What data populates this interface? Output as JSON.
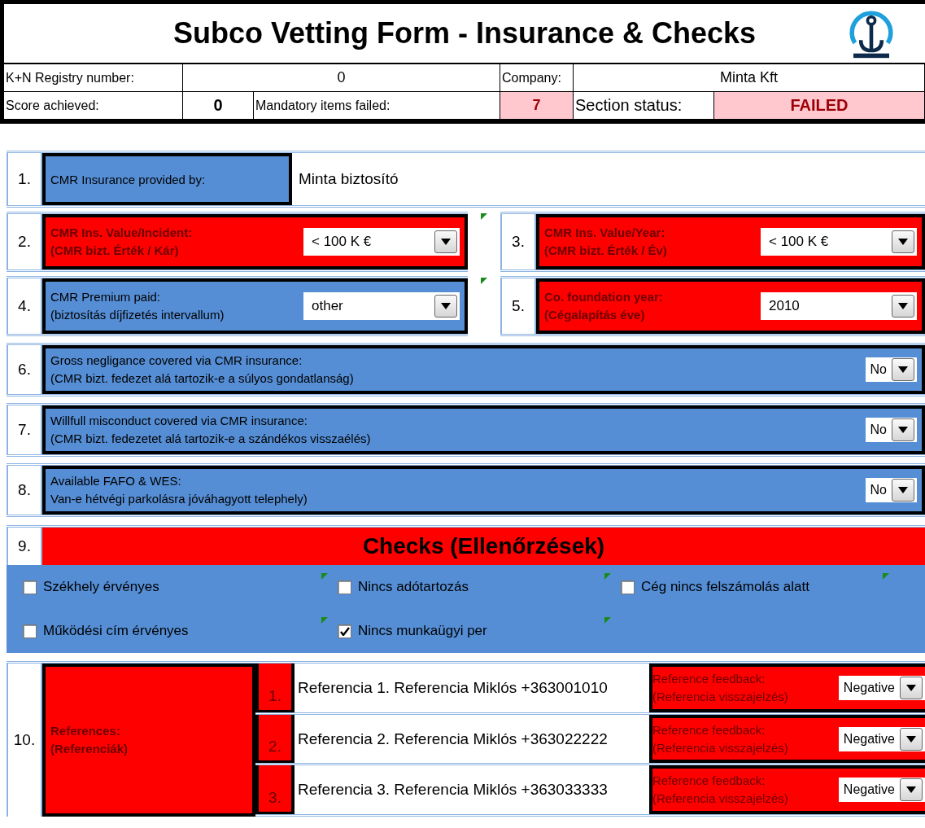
{
  "header": {
    "title": "Subco Vetting Form - Insurance & Checks",
    "registry_label": "K+N Registry number:",
    "registry_value": "0",
    "company_label": "Company:",
    "company_value": "Minta Kft",
    "score_label": "Score achieved:",
    "score_value": "0",
    "mandatory_label": "Mandatory items failed:",
    "mandatory_value": "7",
    "status_label": "Section status:",
    "status_value": "FAILED"
  },
  "provider": {
    "number": "1.",
    "label": "CMR Insurance provided by:",
    "failed": false,
    "value": "Minta biztosító"
  },
  "pairs": [
    {
      "comment": true,
      "items": [
        {
          "number": "2.",
          "label": "CMR Ins. Value/Incident:",
          "sublabel": "(CMR bizt. Érték / Kár)",
          "failed": true,
          "value": "< 100 K €"
        },
        {
          "number": "3.",
          "label": "CMR Ins. Value/Year:",
          "sublabel": "(CMR bizt. Érték / Év)",
          "failed": true,
          "value": "< 100 K €"
        }
      ]
    },
    {
      "comment": true,
      "items": [
        {
          "number": "4.",
          "label": "CMR Premium paid:",
          "sublabel": "(biztosítás díjfizetés intervallum)",
          "failed": false,
          "value": "other"
        },
        {
          "number": "5.",
          "label": "Co. foundation year:",
          "sublabel": "(Cégalapítás éve)",
          "failed": true,
          "value": "2010"
        }
      ]
    }
  ],
  "questions": [
    {
      "number": "6.",
      "label": "Gross negligance covered via CMR insurance:",
      "sublabel": "(CMR bizt. fedezet alá tartozik-e a súlyos gondatlanság)",
      "failed": false,
      "value": "No"
    },
    {
      "number": "7.",
      "label": "Willfull misconduct covered via CMR insurance:",
      "sublabel": "(CMR bizt. fedezetet alá tartozik-e a szándékos visszaélés)",
      "failed": false,
      "value": "No"
    },
    {
      "number": "8.",
      "label": "Available FAFO & WES:",
      "sublabel": "Van-e hétvégi parkolásra jóváhagyott telephely)",
      "failed": false,
      "value": "No"
    }
  ],
  "checks": {
    "number": "9.",
    "title": "Checks (Ellenőrzések)",
    "items": [
      {
        "label": "Székhely érvényes",
        "checked": false,
        "comment": true
      },
      {
        "label": "Nincs adótartozás",
        "checked": false,
        "comment": true
      },
      {
        "label": "Cég nincs felszámolás alatt",
        "checked": false,
        "comment": true
      },
      {
        "label": "Működési cím érvényes",
        "checked": false,
        "comment": true
      },
      {
        "label": "Nincs munkaügyi per",
        "checked": true,
        "comment": true
      }
    ]
  },
  "references": {
    "number": "10.",
    "label": "References:",
    "sublabel": "(Referenciák)",
    "failed": true,
    "rows": [
      {
        "number": "1.",
        "text": "Referencia 1. Referencia Miklós +363001010",
        "feedback_label": "Reference feedback:",
        "feedback_sublabel": "(Referencia visszajelzés)",
        "value": "Negative"
      },
      {
        "number": "2.",
        "text": "Referencia 2. Referencia Miklós +363022222",
        "feedback_label": "Reference feedback:",
        "feedback_sublabel": "(Referencia visszajelzés)",
        "value": "Negative"
      },
      {
        "number": "3.",
        "text": "Referencia 3. Referencia Miklós +363033333",
        "feedback_label": "Reference feedback:",
        "feedback_sublabel": "(Referencia visszajelzés)",
        "value": "Negative"
      }
    ]
  }
}
